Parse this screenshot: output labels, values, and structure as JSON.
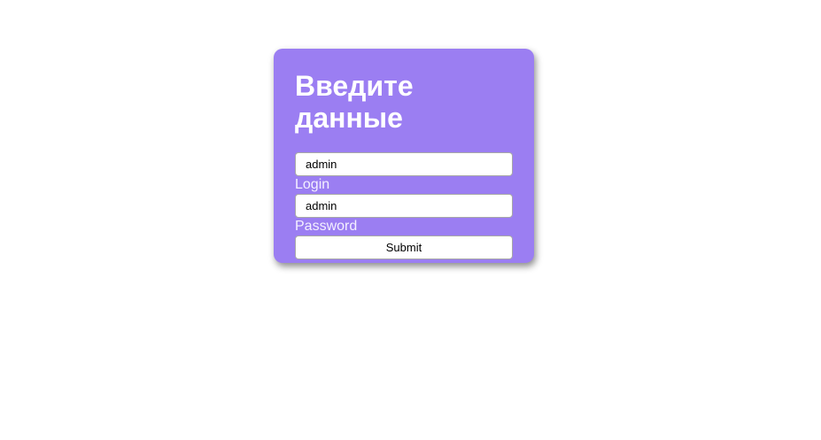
{
  "form": {
    "title_line1": "Введите",
    "title_line2": "данные",
    "login": {
      "value": "admin",
      "label": "Login"
    },
    "password": {
      "value": "admin",
      "label": "Password"
    },
    "submit_label": "Submit"
  },
  "colors": {
    "card_background": "#9b7ef2",
    "label_text": "#f4f0ff",
    "title_text": "#ffffff"
  }
}
